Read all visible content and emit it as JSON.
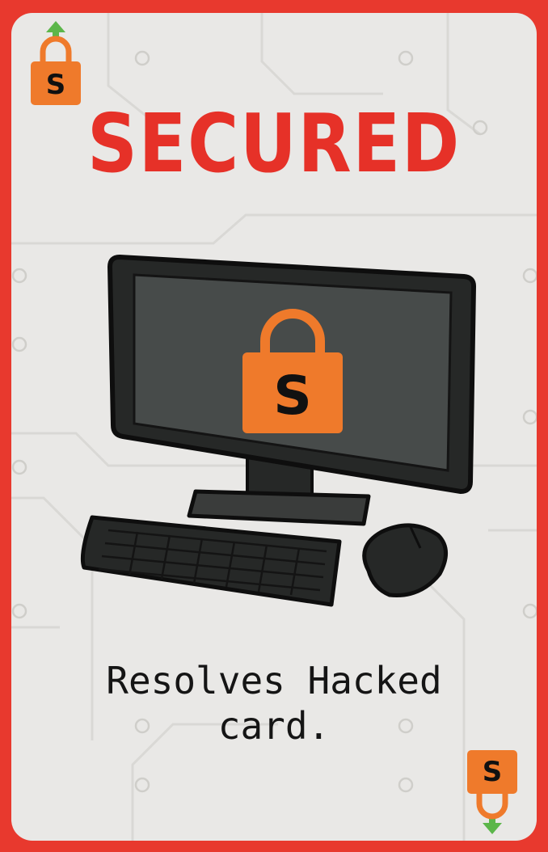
{
  "card": {
    "title": "SECURED",
    "text": "Resolves Hacked card.",
    "lock_letter": "S",
    "corner_icon": "lock-up-arrow-icon",
    "illustration_icons": [
      "computer-monitor-icon",
      "padlock-icon",
      "keyboard-icon",
      "mouse-icon"
    ]
  },
  "colors": {
    "frame": "#e8392e",
    "card_background": "#e9e8e6",
    "title": "#e63128",
    "lock": "#ef7a2b",
    "arrow": "#5cb64a",
    "device": "#262827",
    "screen": "#474b4a"
  }
}
